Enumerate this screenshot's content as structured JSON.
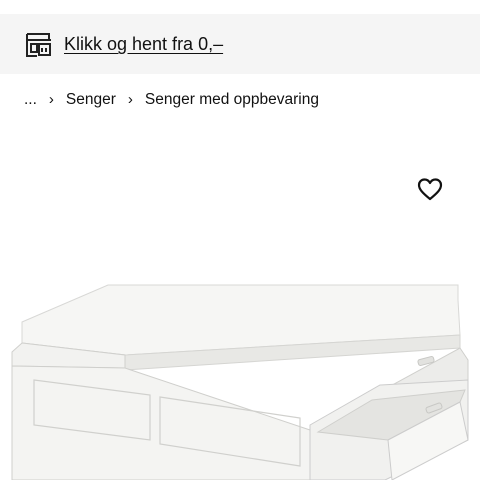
{
  "header": {
    "pickup_text": "Klikk og hent fra 0,–",
    "icon": "store-pickup-icon"
  },
  "breadcrumb": {
    "items": [
      "...",
      "Senger",
      "Senger med oppbevaring"
    ],
    "separator": "›"
  },
  "product": {
    "favorite_icon": "heart-outline-icon",
    "image_alt": "white bed frame with storage drawers"
  },
  "colors": {
    "topbar_bg": "#f5f5f5",
    "text": "#111111",
    "page_bg": "#ffffff"
  }
}
